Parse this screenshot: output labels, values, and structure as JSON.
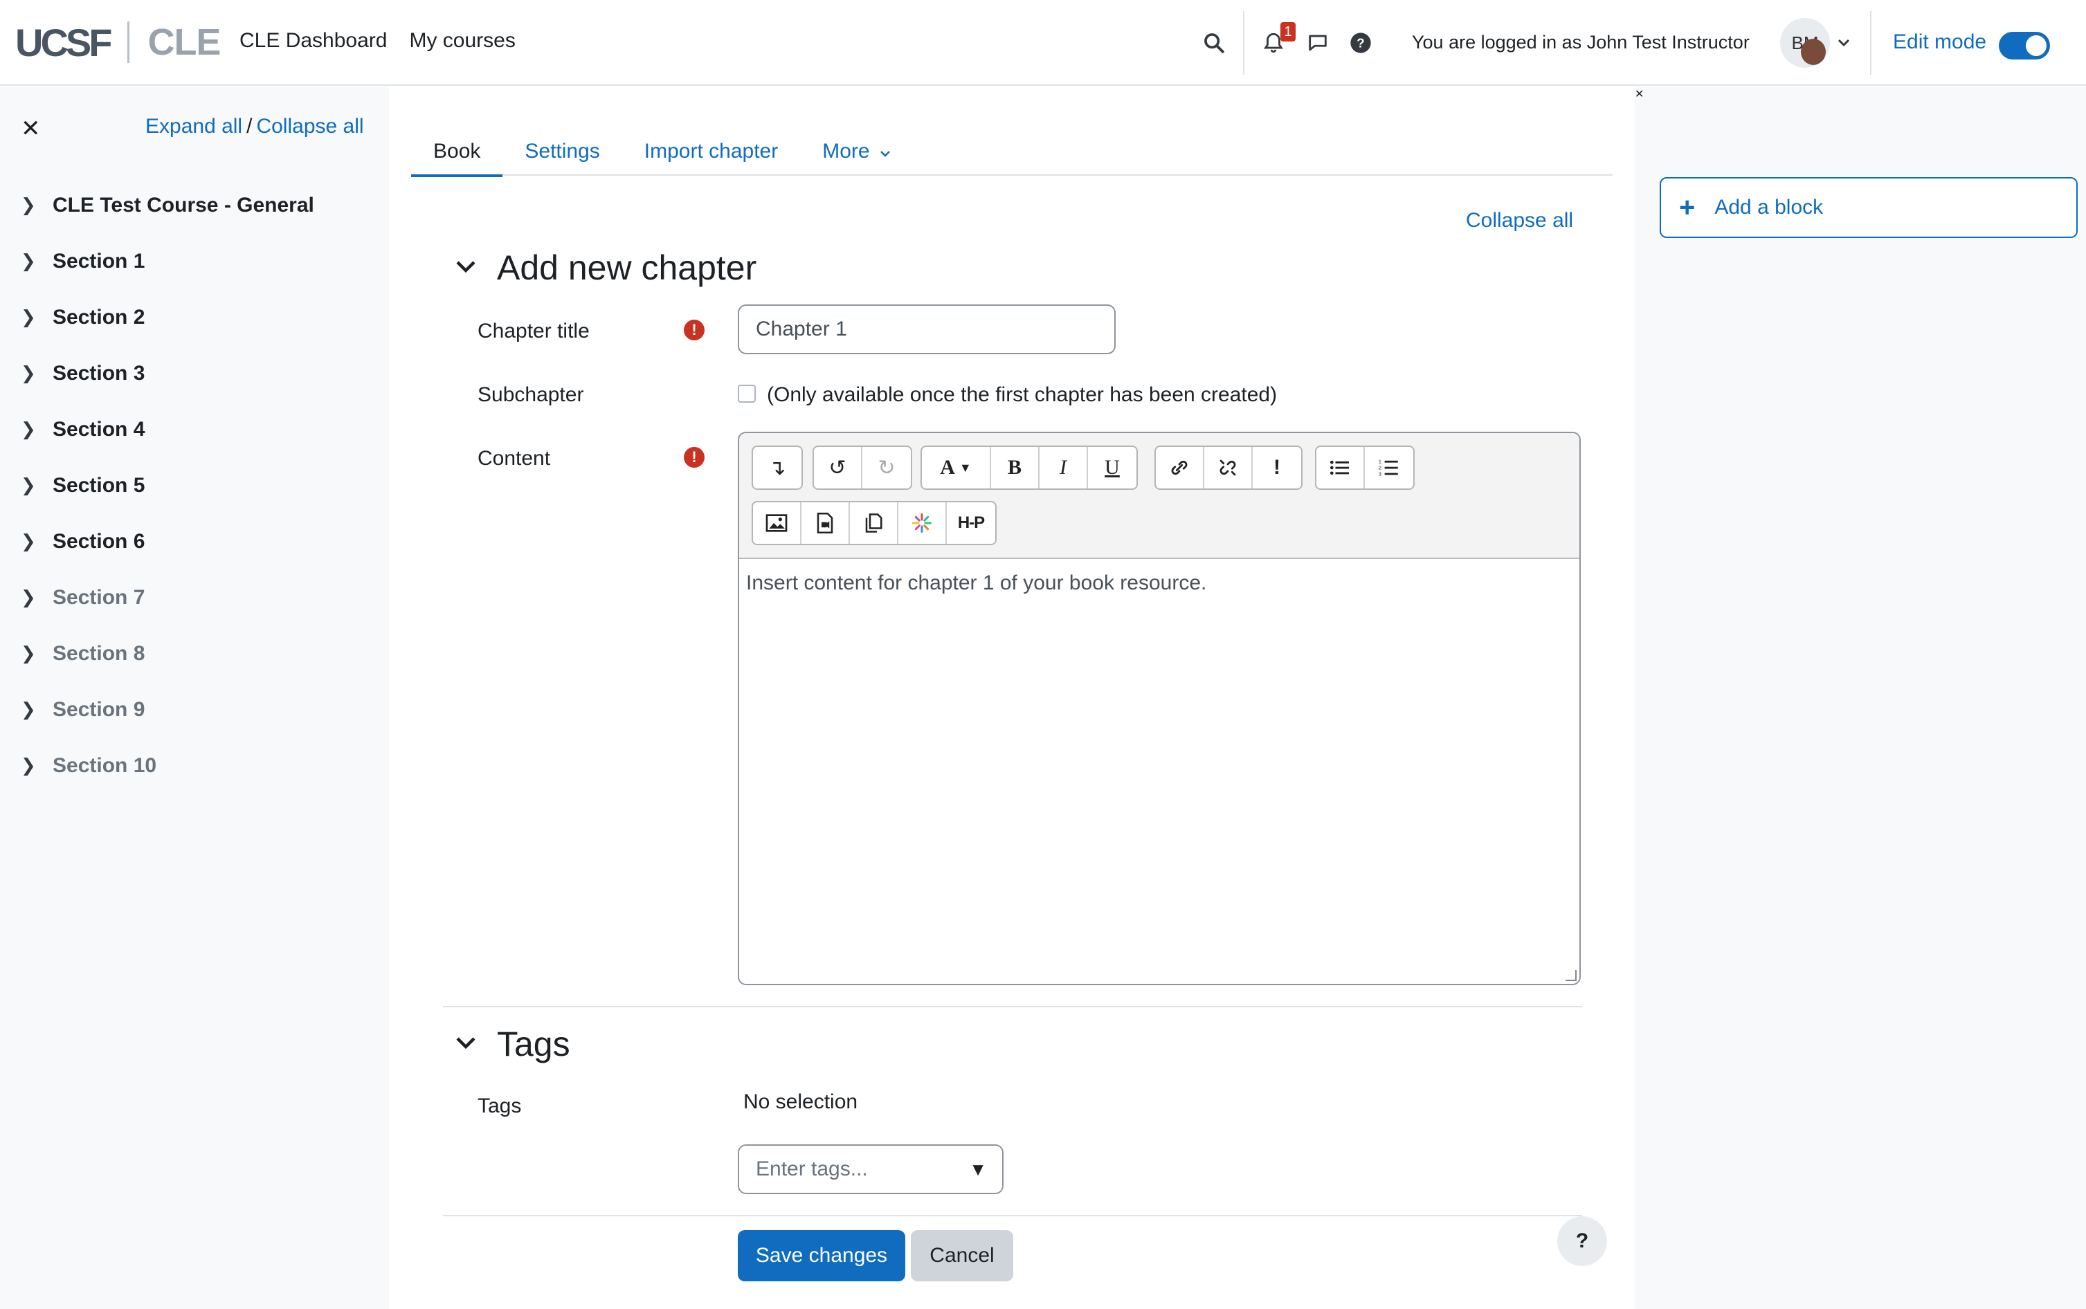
{
  "header": {
    "logo_ucsf": "UCSF",
    "logo_cle": "CLE",
    "nav": [
      "CLE Dashboard",
      "My courses"
    ],
    "notification_count": "1",
    "logged_in_text": "You are logged in as John Test Instructor",
    "avatar_initials": "BM",
    "edit_mode_label": "Edit mode",
    "edit_mode_on": true
  },
  "left_drawer": {
    "expand_all": "Expand all",
    "collapse_all": "Collapse all",
    "sections": [
      "CLE Test Course - General",
      "Section 1",
      "Section 2",
      "Section 3",
      "Section 4",
      "Section 5",
      "Section 6",
      "Section 7",
      "Section 8",
      "Section 9",
      "Section 10"
    ]
  },
  "tabs": {
    "items": [
      "Book",
      "Settings",
      "Import chapter",
      "More"
    ],
    "active": "Book"
  },
  "form": {
    "collapse_all": "Collapse all",
    "section1_title": "Add new chapter",
    "chapter_title_label": "Chapter title",
    "chapter_title_value": "Chapter 1",
    "subchapter_label": "Subchapter",
    "subchapter_note": "(Only available once the first chapter has been created)",
    "content_label": "Content",
    "content_text": "Insert content for chapter 1 of your book resource.",
    "section2_title": "Tags",
    "tags_label": "Tags",
    "tags_no_selection": "No selection",
    "tags_placeholder": "Enter tags...",
    "save_label": "Save changes",
    "cancel_label": "Cancel",
    "help_label": "?"
  },
  "right_drawer": {
    "add_block": "Add a block"
  },
  "colors": {
    "brand": "#0f6cbf",
    "required": "#ca3120"
  }
}
